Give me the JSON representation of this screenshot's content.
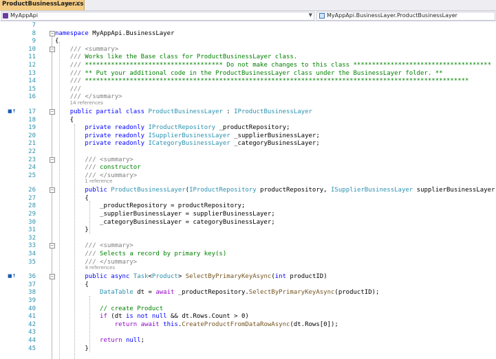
{
  "tab": {
    "title": "ProductBusinessLayer.cs",
    "pin": "⊕",
    "close": "×"
  },
  "nav": {
    "left": "MyAppApi",
    "right": "MyAppApi.BusinessLayer.ProductBusinessLayer",
    "arrow": "▼"
  },
  "lines": [
    {
      "n": "7",
      "segs": []
    },
    {
      "n": "8",
      "fold": "−",
      "segs": [
        {
          "c": "kw",
          "t": "namespace"
        },
        {
          "t": " MyAppApi.BusinessLayer"
        }
      ]
    },
    {
      "n": "9",
      "segs": [
        {
          "t": "{"
        }
      ]
    },
    {
      "n": "10",
      "fold": "−",
      "segs": [
        {
          "t": "    "
        },
        {
          "c": "cmg",
          "t": "/// <summary>"
        }
      ]
    },
    {
      "n": "11",
      "segs": [
        {
          "t": "    "
        },
        {
          "c": "cmg",
          "t": "///"
        },
        {
          "c": "cm",
          "t": " Works like the Base class for ProductBusinessLayer class."
        }
      ]
    },
    {
      "n": "12",
      "segs": [
        {
          "t": "    "
        },
        {
          "c": "cmg",
          "t": "///"
        },
        {
          "c": "cm",
          "t": " ************************************* Do not make changes to this class *************************************"
        }
      ]
    },
    {
      "n": "13",
      "segs": [
        {
          "t": "    "
        },
        {
          "c": "cmg",
          "t": "///"
        },
        {
          "c": "cm",
          "t": " ** Put your additional code in the ProductBusinessLayer class under the BusinessLayer folder. **"
        }
      ]
    },
    {
      "n": "14",
      "segs": [
        {
          "t": "    "
        },
        {
          "c": "cmg",
          "t": "///"
        },
        {
          "c": "cm",
          "t": " *******************************************************************************************************"
        }
      ]
    },
    {
      "n": "15",
      "segs": [
        {
          "t": "    "
        },
        {
          "c": "cmg",
          "t": "///"
        }
      ]
    },
    {
      "n": "16",
      "segs": [
        {
          "t": "    "
        },
        {
          "c": "cmg",
          "t": "/// </summary>"
        }
      ]
    },
    {
      "ref": "14 references",
      "indent": 4
    },
    {
      "n": "17",
      "fold": "−",
      "mark": "■↑",
      "segs": [
        {
          "t": "    "
        },
        {
          "c": "kw",
          "t": "public partial class"
        },
        {
          "t": " "
        },
        {
          "c": "ty",
          "t": "ProductBusinessLayer"
        },
        {
          "t": " : "
        },
        {
          "c": "ty",
          "t": "IProductBusinessLayer"
        }
      ]
    },
    {
      "n": "18",
      "segs": [
        {
          "t": "    {"
        }
      ]
    },
    {
      "n": "19",
      "segs": [
        {
          "t": "        "
        },
        {
          "c": "kw",
          "t": "private readonly"
        },
        {
          "t": " "
        },
        {
          "c": "ty",
          "t": "IProductRepository"
        },
        {
          "t": " _productRepository;"
        }
      ]
    },
    {
      "n": "20",
      "segs": [
        {
          "t": "        "
        },
        {
          "c": "kw",
          "t": "private readonly"
        },
        {
          "t": " "
        },
        {
          "c": "ty",
          "t": "ISupplierBusinessLayer"
        },
        {
          "t": " _supplierBusinessLayer;"
        }
      ]
    },
    {
      "n": "21",
      "segs": [
        {
          "t": "        "
        },
        {
          "c": "kw",
          "t": "private readonly"
        },
        {
          "t": " "
        },
        {
          "c": "ty",
          "t": "ICategoryBusinessLayer"
        },
        {
          "t": " _categoryBusinessLayer;"
        }
      ]
    },
    {
      "n": "22",
      "segs": []
    },
    {
      "n": "23",
      "fold": "−",
      "segs": [
        {
          "t": "        "
        },
        {
          "c": "cmg",
          "t": "/// <summary>"
        }
      ]
    },
    {
      "n": "24",
      "segs": [
        {
          "t": "        "
        },
        {
          "c": "cmg",
          "t": "///"
        },
        {
          "c": "cm",
          "t": " constructor"
        }
      ]
    },
    {
      "n": "25",
      "segs": [
        {
          "t": "        "
        },
        {
          "c": "cmg",
          "t": "/// </summary>"
        }
      ]
    },
    {
      "ref": "1 reference",
      "indent": 8
    },
    {
      "n": "26",
      "fold": "−",
      "segs": [
        {
          "t": "        "
        },
        {
          "c": "kw",
          "t": "public"
        },
        {
          "t": " "
        },
        {
          "c": "ty",
          "t": "ProductBusinessLayer"
        },
        {
          "t": "("
        },
        {
          "c": "ty",
          "t": "IProductRepository"
        },
        {
          "t": " productRepository, "
        },
        {
          "c": "ty",
          "t": "ISupplierBusinessLayer"
        },
        {
          "t": " supplierBusinessLayer,"
        }
      ]
    },
    {
      "n": "27",
      "segs": [
        {
          "t": "        {"
        }
      ]
    },
    {
      "n": "28",
      "segs": [
        {
          "t": "            _productRepository = productRepository;"
        }
      ]
    },
    {
      "n": "29",
      "segs": [
        {
          "t": "            _supplierBusinessLayer = supplierBusinessLayer;"
        }
      ]
    },
    {
      "n": "30",
      "segs": [
        {
          "t": "            _categoryBusinessLayer = categoryBusinessLayer;"
        }
      ]
    },
    {
      "n": "31",
      "segs": [
        {
          "t": "        }"
        }
      ]
    },
    {
      "n": "32",
      "segs": []
    },
    {
      "n": "33",
      "fold": "−",
      "segs": [
        {
          "t": "        "
        },
        {
          "c": "cmg",
          "t": "/// <summary>"
        }
      ]
    },
    {
      "n": "34",
      "segs": [
        {
          "t": "        "
        },
        {
          "c": "cmg",
          "t": "///"
        },
        {
          "c": "cm",
          "t": " Selects a record by primary key(s)"
        }
      ]
    },
    {
      "n": "35",
      "segs": [
        {
          "t": "        "
        },
        {
          "c": "cmg",
          "t": "/// </summary>"
        }
      ]
    },
    {
      "ref": "4 references",
      "indent": 8
    },
    {
      "n": "36",
      "fold": "−",
      "mark": "■↑",
      "segs": [
        {
          "t": "        "
        },
        {
          "c": "kw",
          "t": "public async"
        },
        {
          "t": " "
        },
        {
          "c": "ty",
          "t": "Task"
        },
        {
          "t": "<"
        },
        {
          "c": "ty",
          "t": "Product"
        },
        {
          "t": "> "
        },
        {
          "c": "me",
          "t": "SelectByPrimaryKeyAsync"
        },
        {
          "t": "("
        },
        {
          "c": "kw",
          "t": "int"
        },
        {
          "t": " productID)"
        }
      ]
    },
    {
      "n": "37",
      "segs": [
        {
          "t": "        {"
        }
      ]
    },
    {
      "n": "38",
      "segs": [
        {
          "t": "            "
        },
        {
          "c": "ty",
          "t": "DataTable"
        },
        {
          "t": " dt = "
        },
        {
          "c": "ctl",
          "t": "await"
        },
        {
          "t": " _productRepository."
        },
        {
          "c": "me",
          "t": "SelectByPrimaryKeyAsync"
        },
        {
          "t": "(productID);"
        }
      ]
    },
    {
      "n": "39",
      "segs": []
    },
    {
      "n": "40",
      "segs": [
        {
          "t": "            "
        },
        {
          "c": "cm",
          "t": "// create Product"
        }
      ]
    },
    {
      "n": "41",
      "segs": [
        {
          "t": "            "
        },
        {
          "c": "ctl",
          "t": "if"
        },
        {
          "t": " (dt "
        },
        {
          "c": "kw",
          "t": "is not null"
        },
        {
          "t": " && dt.Rows.Count > 0)"
        }
      ]
    },
    {
      "n": "42",
      "segs": [
        {
          "t": "                "
        },
        {
          "c": "ctl",
          "t": "return await"
        },
        {
          "t": " "
        },
        {
          "c": "kw",
          "t": "this"
        },
        {
          "t": "."
        },
        {
          "c": "me",
          "t": "CreateProductFromDataRowAsync"
        },
        {
          "t": "(dt.Rows[0]);"
        }
      ]
    },
    {
      "n": "43",
      "segs": []
    },
    {
      "n": "44",
      "segs": [
        {
          "t": "            "
        },
        {
          "c": "ctl",
          "t": "return"
        },
        {
          "t": " "
        },
        {
          "c": "kw",
          "t": "null"
        },
        {
          "t": ";"
        }
      ]
    },
    {
      "n": "45",
      "segs": [
        {
          "t": "        }"
        }
      ]
    }
  ]
}
